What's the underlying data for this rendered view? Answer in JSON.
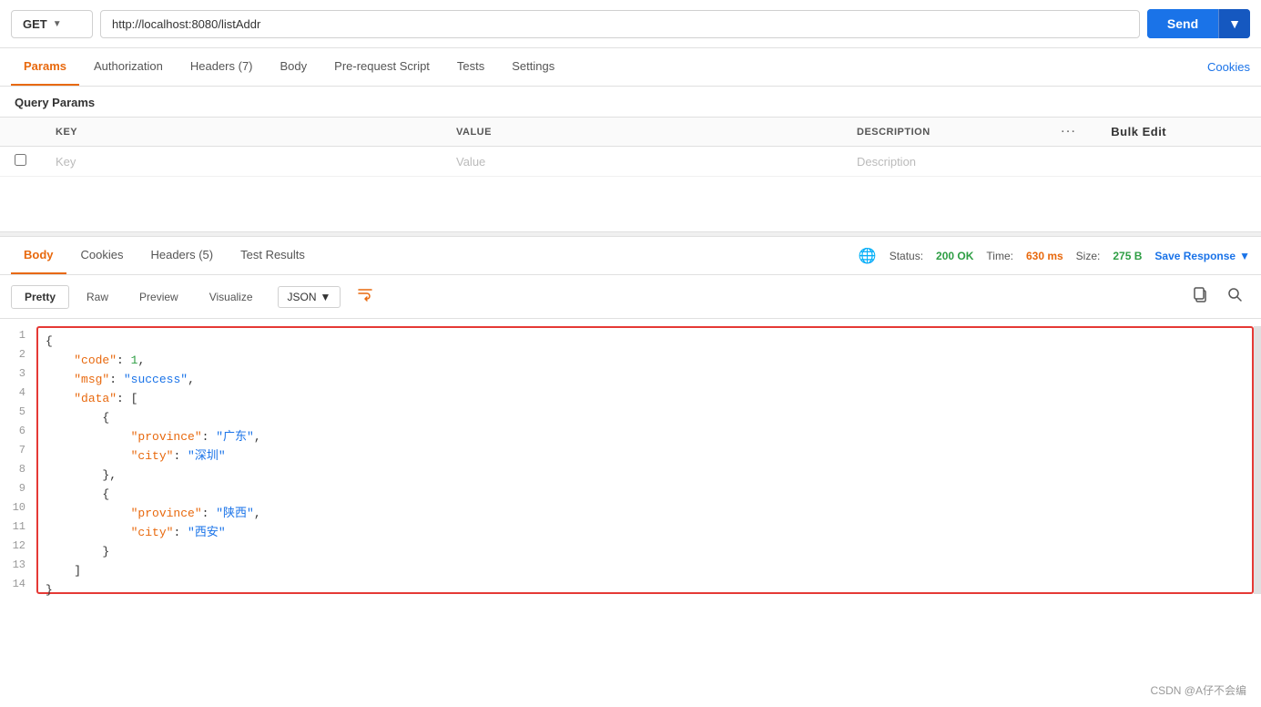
{
  "url_bar": {
    "method": "GET",
    "url": "http://localhost:8080/listAddr",
    "send_label": "Send"
  },
  "request_tabs": {
    "tabs": [
      {
        "id": "params",
        "label": "Params",
        "active": true
      },
      {
        "id": "authorization",
        "label": "Authorization"
      },
      {
        "id": "headers",
        "label": "Headers (7)"
      },
      {
        "id": "body",
        "label": "Body"
      },
      {
        "id": "pre-request",
        "label": "Pre-request Script"
      },
      {
        "id": "tests",
        "label": "Tests"
      },
      {
        "id": "settings",
        "label": "Settings"
      }
    ],
    "cookies_label": "Cookies"
  },
  "query_params": {
    "section_label": "Query Params",
    "columns": {
      "key": "KEY",
      "value": "VALUE",
      "description": "DESCRIPTION",
      "bulk_edit": "Bulk Edit"
    },
    "placeholder_row": {
      "key": "Key",
      "value": "Value",
      "description": "Description"
    }
  },
  "response_tabs": {
    "tabs": [
      {
        "id": "body",
        "label": "Body",
        "active": true
      },
      {
        "id": "cookies",
        "label": "Cookies"
      },
      {
        "id": "headers",
        "label": "Headers (5)"
      },
      {
        "id": "test_results",
        "label": "Test Results"
      }
    ],
    "status": {
      "label": "Status:",
      "code": "200 OK",
      "time_label": "Time:",
      "time_value": "630 ms",
      "size_label": "Size:",
      "size_value": "275 B"
    },
    "save_response": "Save Response"
  },
  "format_bar": {
    "tabs": [
      {
        "id": "pretty",
        "label": "Pretty",
        "active": true
      },
      {
        "id": "raw",
        "label": "Raw"
      },
      {
        "id": "preview",
        "label": "Preview"
      },
      {
        "id": "visualize",
        "label": "Visualize"
      }
    ],
    "json_selector": "JSON"
  },
  "response_body": {
    "lines": [
      {
        "num": 1,
        "content": "{",
        "type": "brace"
      },
      {
        "num": 2,
        "content": "    \"code\": 1,",
        "type": "key_num",
        "key": "code",
        "value": "1"
      },
      {
        "num": 3,
        "content": "    \"msg\": \"success\",",
        "type": "key_str",
        "key": "msg",
        "value": "success"
      },
      {
        "num": 4,
        "content": "    \"data\": [",
        "type": "key_arr",
        "key": "data"
      },
      {
        "num": 5,
        "content": "        {",
        "type": "brace"
      },
      {
        "num": 6,
        "content": "            \"province\": \"广东\",",
        "type": "key_str",
        "key": "province",
        "value": "广东"
      },
      {
        "num": 7,
        "content": "            \"city\": \"深圳\"",
        "type": "key_str",
        "key": "city",
        "value": "深圳"
      },
      {
        "num": 8,
        "content": "        },",
        "type": "brace"
      },
      {
        "num": 9,
        "content": "        {",
        "type": "brace"
      },
      {
        "num": 10,
        "content": "            \"province\": \"陕西\",",
        "type": "key_str",
        "key": "province",
        "value": "陕西"
      },
      {
        "num": 11,
        "content": "            \"city\": \"西安\"",
        "type": "key_str",
        "key": "city",
        "value": "西安"
      },
      {
        "num": 12,
        "content": "        }",
        "type": "brace"
      },
      {
        "num": 13,
        "content": "    ]",
        "type": "bracket"
      },
      {
        "num": 14,
        "content": "}",
        "type": "brace"
      }
    ]
  },
  "watermark": "CSDN @A仔不会编"
}
